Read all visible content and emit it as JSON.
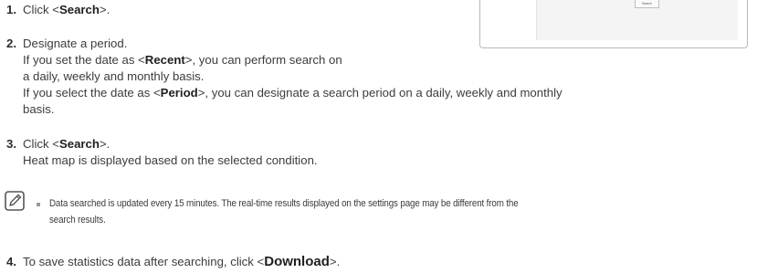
{
  "steps": [
    {
      "number": "1.",
      "lines": [
        {
          "before": "Click <",
          "bold": "Search",
          "after": ">."
        }
      ]
    },
    {
      "number": "2.",
      "lines": [
        {
          "text": "Designate a period."
        },
        {
          "before": "If you set the date as <",
          "bold": "Recent",
          "after": ">, you can perform search on"
        },
        {
          "text": "a daily, weekly and monthly basis."
        },
        {
          "before": "If you select the date as <",
          "bold": "Period",
          "after": ">, you can designate a search period on a daily, weekly and monthly"
        },
        {
          "text": "basis."
        }
      ]
    },
    {
      "number": "3.",
      "lines": [
        {
          "before": "Click <",
          "bold": "Search",
          "after": ">."
        },
        {
          "text": "Heat map is displayed based on the selected condition."
        }
      ]
    },
    {
      "number": "4.",
      "lines": [
        {
          "before": "To save statistics data after searching, click <",
          "bold": "Download",
          "after": ">."
        }
      ]
    }
  ],
  "note": {
    "line1": "Data searched is updated every 15 minutes. The real-time results displayed on the settings page may be different from the",
    "line2": "search results."
  },
  "panel": {
    "search_button_label": "Search"
  }
}
